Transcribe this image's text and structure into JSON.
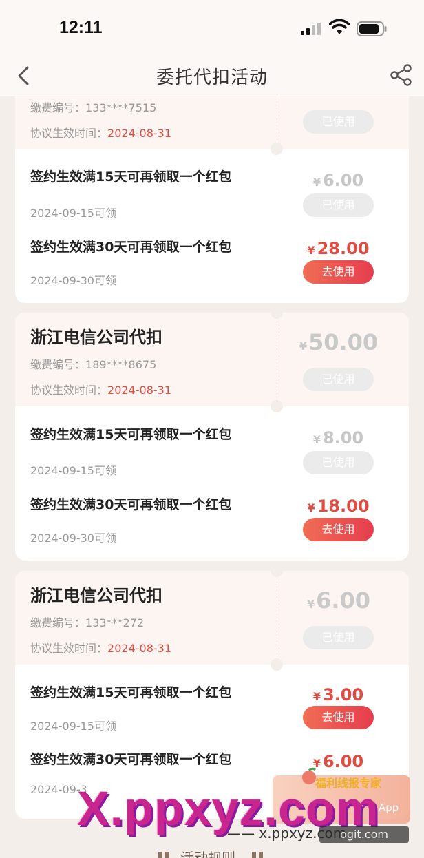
{
  "status_bar": {
    "time": "12:11"
  },
  "nav": {
    "title": "委托代扣活动"
  },
  "cards": [
    {
      "company": "",
      "account_label": "缴费编号：",
      "account_value": "133****7515",
      "date_label": "协议生效时间：",
      "date_value": "2024-08-31",
      "amount_currency": "",
      "amount": "",
      "status_button": "已使用",
      "rewards": [
        {
          "title": "签约生效满15天可再领取一个红包",
          "date": "2024-09-15可领",
          "currency": "¥",
          "amount": "6.00",
          "button": "已使用",
          "state": "used"
        },
        {
          "title": "签约生效满30天可再领取一个红包",
          "date": "2024-09-30可领",
          "currency": "¥",
          "amount": "28.00",
          "button": "去使用",
          "state": "active"
        }
      ]
    },
    {
      "company": "浙江电信公司代扣",
      "account_label": "缴费编号：",
      "account_value": "189****8675",
      "date_label": "协议生效时间：",
      "date_value": "2024-08-31",
      "amount_currency": "¥",
      "amount": "50.00",
      "status_button": "已使用",
      "rewards": [
        {
          "title": "签约生效满15天可再领取一个红包",
          "date": "2024-09-15可领",
          "currency": "¥",
          "amount": "8.00",
          "button": "已使用",
          "state": "used"
        },
        {
          "title": "签约生效满30天可再领取一个红包",
          "date": "2024-09-30可领",
          "currency": "¥",
          "amount": "18.00",
          "button": "去使用",
          "state": "active"
        }
      ]
    },
    {
      "company": "浙江电信公司代扣",
      "account_label": "缴费编号：",
      "account_value": "133***272",
      "date_label": "协议生效时间：",
      "date_value": "2024-08-31",
      "amount_currency": "¥",
      "amount": "6.00",
      "status_button": "已使用",
      "rewards": [
        {
          "title": "签约生效满15天可再领取一个红包",
          "date": "2024-09-15可领",
          "currency": "¥",
          "amount": "3.00",
          "button": "去使用",
          "state": "active"
        },
        {
          "title": "签约生效满30天可再领取一个红包",
          "date": "2024-09-3",
          "currency": "¥",
          "amount": "6.00",
          "button": "",
          "state": "active"
        }
      ]
    }
  ],
  "footer": {
    "rules_label": "活动规则"
  },
  "watermarks": {
    "big": "X.ppxyz.com",
    "small": "—— x.ppxyz.com",
    "badge": "福利线报专家",
    "badge_app": "App",
    "dark": "ogit.com"
  }
}
